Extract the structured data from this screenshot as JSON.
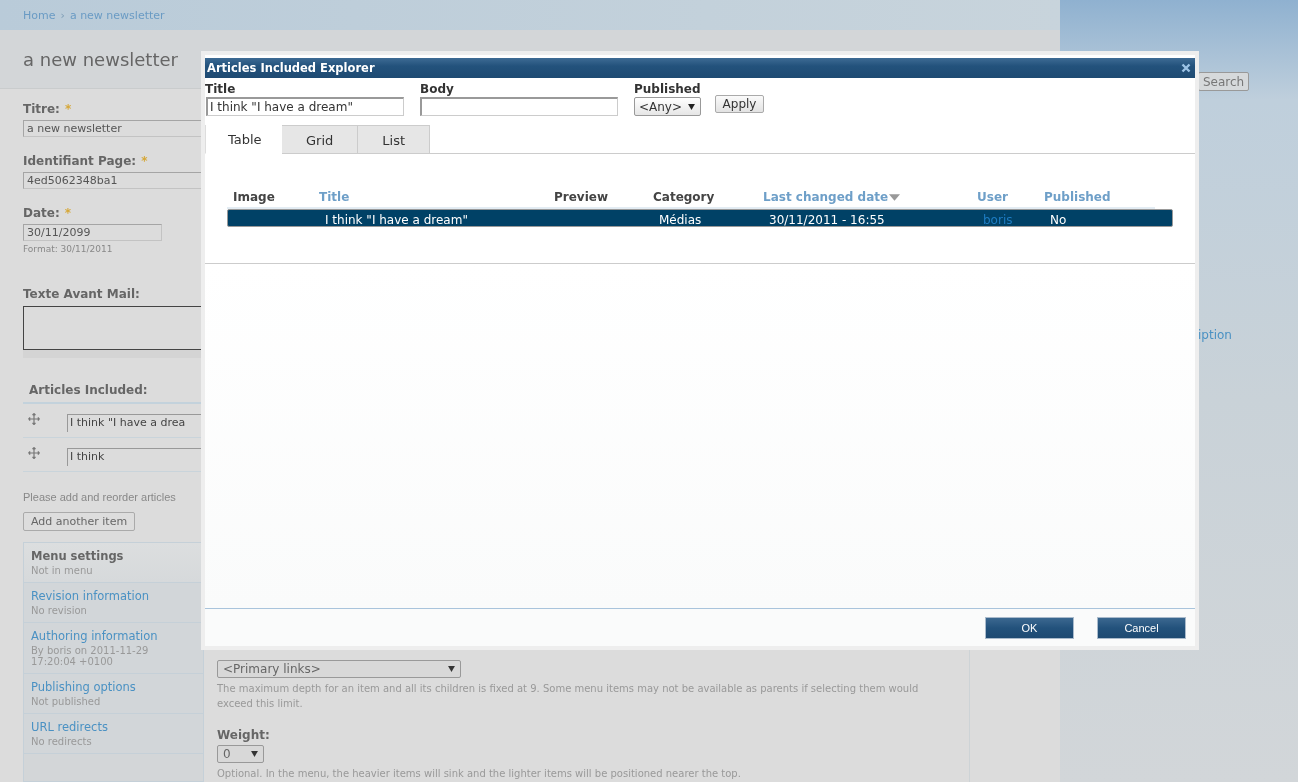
{
  "breadcrumb": [
    {
      "label": "Home"
    },
    {
      "label": "a new newsletter"
    }
  ],
  "breadcrumb_separator": "›",
  "page_title": "a new newsletter",
  "form": {
    "fields": [
      {
        "label": "Titre:",
        "required_mark": "*",
        "value": "a new newsletter"
      },
      {
        "label": "Identifiant Page:",
        "required_mark": "*",
        "value": "4ed5062348ba1"
      },
      {
        "label": "Date:",
        "required_mark": "*",
        "value": "30/11/2099",
        "hint": "Format:  30/11/2011"
      }
    ],
    "textarea_label": "Texte Avant Mail:",
    "articles_label": "Articles Included:",
    "articles": [
      {
        "value": "I think \"I have a drea"
      },
      {
        "value": "I think"
      }
    ],
    "articles_help": "Please add and reorder articles",
    "add_button": "Add another item"
  },
  "vertical_tabs": [
    {
      "title": "Menu settings",
      "summary": "Not in menu",
      "selected": true
    },
    {
      "title": "Revision information",
      "summary": "No revision",
      "selected": false
    },
    {
      "title": "Authoring information",
      "summary": "By boris on 2011-11-29 17:20:04 +0100",
      "selected": false
    },
    {
      "title": "Publishing options",
      "summary": "Not published",
      "selected": false
    },
    {
      "title": "URL redirects",
      "summary": "No redirects",
      "selected": false
    }
  ],
  "menu_pane": {
    "parent_select": "<Primary links>",
    "parent_help": "The maximum depth for an item and all its children is fixed at 9. Some menu items may not be available as parents if selecting them would exceed this limit.",
    "weight_label": "Weight:",
    "weight_select": "0",
    "weight_help": "Optional. In the menu, the heavier items will sink and the lighter items will be positioned nearer the top."
  },
  "sidebar": {
    "search_button": "Search",
    "link": "iption"
  },
  "dialog": {
    "title": "Articles Included Explorer",
    "filters": [
      {
        "kind": "text",
        "label": "Title",
        "value": "I think \"I have a dream\""
      },
      {
        "kind": "text",
        "label": "Body"
      },
      {
        "kind": "select",
        "label": "Published",
        "value": "<Any>"
      }
    ],
    "apply_button": "Apply",
    "tabs": [
      {
        "label": "Table",
        "selected": true
      },
      {
        "label": "Grid",
        "selected": false
      },
      {
        "label": "List",
        "selected": false
      }
    ],
    "table": {
      "columns": [
        {
          "label": "Image",
          "link": false,
          "sorted": false
        },
        {
          "label": "Title",
          "link": true,
          "sorted": false
        },
        {
          "label": "Preview",
          "link": false,
          "sorted": false
        },
        {
          "label": "Category",
          "link": false,
          "sorted": false
        },
        {
          "label": "Last changed date",
          "link": true,
          "sorted": true
        },
        {
          "label": "User",
          "link": true,
          "sorted": false
        },
        {
          "label": "Published",
          "link": true,
          "sorted": false
        }
      ],
      "rows": [
        {
          "selected": true,
          "title": "I think \"I have a dream\"",
          "category": "Médias",
          "changed": "30/11/2011 - 16:55",
          "user": "boris",
          "published": "No"
        }
      ]
    },
    "buttons": [
      {
        "label": "OK"
      },
      {
        "label": "Cancel"
      }
    ]
  }
}
